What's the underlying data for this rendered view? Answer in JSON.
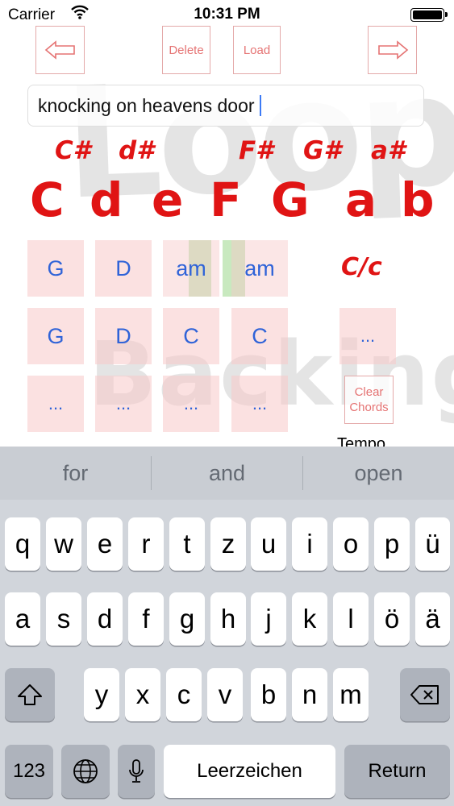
{
  "status_bar": {
    "carrier": "Carrier",
    "time": "10:31 PM"
  },
  "toolbar": {
    "back_icon": "arrow-left-icon",
    "delete_label": "Delete",
    "load_label": "Load",
    "forward_icon": "arrow-right-icon"
  },
  "song_title": {
    "value": "knocking on heavens door"
  },
  "key_selector": {
    "sharps": [
      "C#",
      "d#",
      "F#",
      "G#",
      "a#"
    ],
    "notes": [
      "C",
      "d",
      "e",
      "F",
      "G",
      "a",
      "b"
    ]
  },
  "chord_grid": {
    "row1": [
      "G",
      "D",
      "am",
      "am"
    ],
    "row2": [
      "G",
      "D",
      "C",
      "C"
    ],
    "row3": [
      "...",
      "...",
      "...",
      "..."
    ],
    "mode": "C/c",
    "extra": "...",
    "clear_label": "Clear Chords",
    "tempo_label": "Tempo"
  },
  "colors": {
    "accent_red": "#e01414",
    "chord_blue": "#2f63d8",
    "cell_pink": "#f7c8c8",
    "highlight_green": "#b6e1aa"
  },
  "keyboard": {
    "suggestions": [
      "for",
      "and",
      "open"
    ],
    "row1": [
      "q",
      "w",
      "e",
      "r",
      "t",
      "z",
      "u",
      "i",
      "o",
      "p",
      "ü"
    ],
    "row2": [
      "a",
      "s",
      "d",
      "f",
      "g",
      "h",
      "j",
      "k",
      "l",
      "ö",
      "ä"
    ],
    "row3": [
      "y",
      "x",
      "c",
      "v",
      "b",
      "n",
      "m"
    ],
    "numbers_label": "123",
    "globe_icon": "globe-icon",
    "mic_icon": "microphone-icon",
    "space_label": "Leerzeichen",
    "return_label": "Return",
    "shift_icon": "shift-icon",
    "backspace_icon": "backspace-icon"
  }
}
